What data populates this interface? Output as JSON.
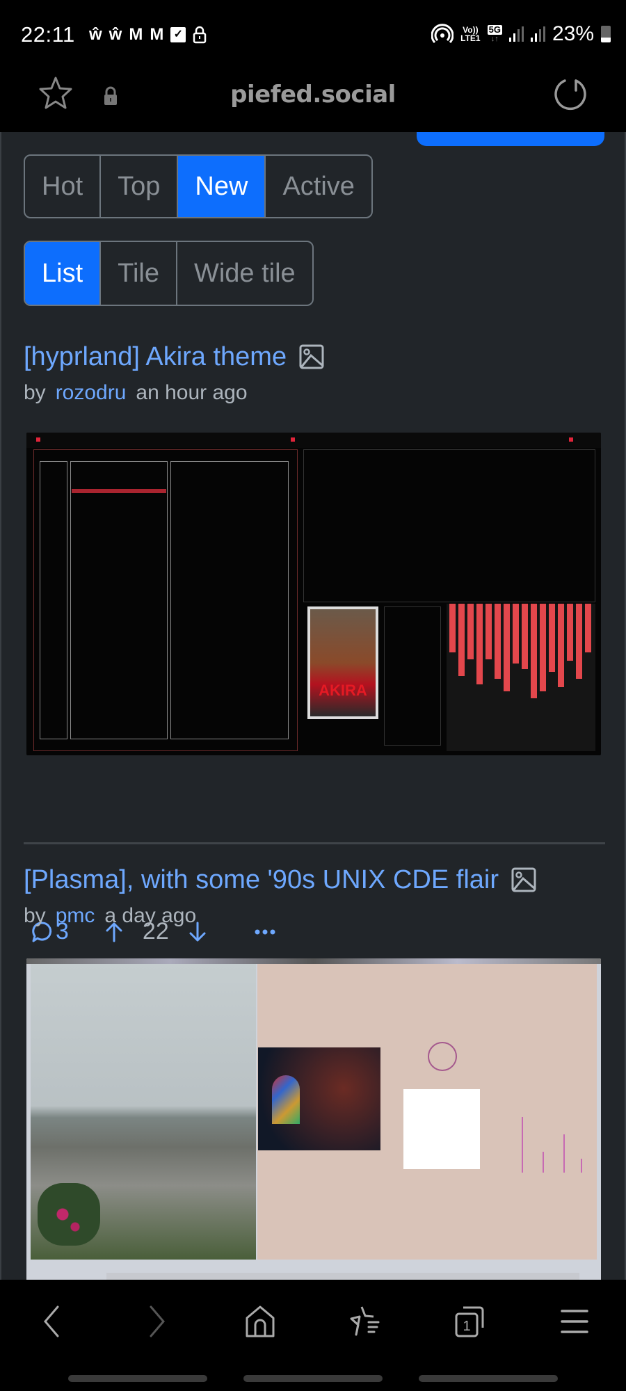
{
  "status_bar": {
    "time": "22:11",
    "notification_icons": [
      "w-app-icon",
      "w-app-icon",
      "m-app-icon",
      "m-app-icon",
      "checkbox-icon",
      "lock-icon"
    ],
    "network_labels": {
      "volte": "Vo))",
      "lte": "LTE1",
      "five_g": "5G"
    },
    "battery_percent": "23%"
  },
  "address_bar": {
    "url": "piefed.social"
  },
  "sort_tabs": [
    {
      "label": "Hot",
      "active": false
    },
    {
      "label": "Top",
      "active": false
    },
    {
      "label": "New",
      "active": true
    },
    {
      "label": "Active",
      "active": false
    }
  ],
  "layout_tabs": [
    {
      "label": "List",
      "active": true
    },
    {
      "label": "Tile",
      "active": false
    },
    {
      "label": "Wide tile",
      "active": false
    }
  ],
  "posts": [
    {
      "title": "[hyprland] Akira theme",
      "type_icon": "image-icon",
      "by_label": "by",
      "author": "rozodru",
      "time": "an hour ago",
      "image_alt": "Hyprland desktop screenshot with red Akira theme, file manager, music player, AKIRA poster and audio visualizer",
      "poster_text": "AKIRA",
      "comments": "3",
      "score": "22",
      "more_label": "..."
    },
    {
      "title": "[Plasma], with some '90s UNIX CDE flair",
      "type_icon": "image-icon",
      "by_label": "by",
      "author": "pmc",
      "time": "a day ago",
      "image_alt": "KDE Plasma desktop with foggy rocky coastline photo and beige CDE-style widgets"
    }
  ],
  "bottom_nav": {
    "items": [
      "back",
      "forward",
      "home",
      "bookmarks",
      "tabs",
      "menu"
    ],
    "tab_count": "1"
  },
  "colors": {
    "accent": "#0d6efd",
    "link": "#6ea8fe",
    "page_bg": "#212529",
    "muted_text": "#adb5bd"
  }
}
